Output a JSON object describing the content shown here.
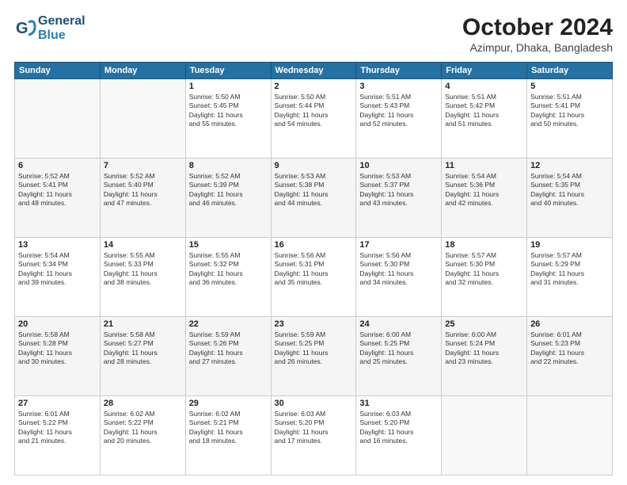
{
  "header": {
    "logo_line1": "General",
    "logo_line2": "Blue",
    "month": "October 2024",
    "location": "Azimpur, Dhaka, Bangladesh"
  },
  "weekdays": [
    "Sunday",
    "Monday",
    "Tuesday",
    "Wednesday",
    "Thursday",
    "Friday",
    "Saturday"
  ],
  "weeks": [
    [
      {
        "day": "",
        "info": ""
      },
      {
        "day": "",
        "info": ""
      },
      {
        "day": "1",
        "info": "Sunrise: 5:50 AM\nSunset: 5:45 PM\nDaylight: 11 hours\nand 55 minutes."
      },
      {
        "day": "2",
        "info": "Sunrise: 5:50 AM\nSunset: 5:44 PM\nDaylight: 11 hours\nand 54 minutes."
      },
      {
        "day": "3",
        "info": "Sunrise: 5:51 AM\nSunset: 5:43 PM\nDaylight: 11 hours\nand 52 minutes."
      },
      {
        "day": "4",
        "info": "Sunrise: 5:51 AM\nSunset: 5:42 PM\nDaylight: 11 hours\nand 51 minutes."
      },
      {
        "day": "5",
        "info": "Sunrise: 5:51 AM\nSunset: 5:41 PM\nDaylight: 11 hours\nand 50 minutes."
      }
    ],
    [
      {
        "day": "6",
        "info": "Sunrise: 5:52 AM\nSunset: 5:41 PM\nDaylight: 11 hours\nand 48 minutes."
      },
      {
        "day": "7",
        "info": "Sunrise: 5:52 AM\nSunset: 5:40 PM\nDaylight: 11 hours\nand 47 minutes."
      },
      {
        "day": "8",
        "info": "Sunrise: 5:52 AM\nSunset: 5:39 PM\nDaylight: 11 hours\nand 46 minutes."
      },
      {
        "day": "9",
        "info": "Sunrise: 5:53 AM\nSunset: 5:38 PM\nDaylight: 11 hours\nand 44 minutes."
      },
      {
        "day": "10",
        "info": "Sunrise: 5:53 AM\nSunset: 5:37 PM\nDaylight: 11 hours\nand 43 minutes."
      },
      {
        "day": "11",
        "info": "Sunrise: 5:54 AM\nSunset: 5:36 PM\nDaylight: 11 hours\nand 42 minutes."
      },
      {
        "day": "12",
        "info": "Sunrise: 5:54 AM\nSunset: 5:35 PM\nDaylight: 11 hours\nand 40 minutes."
      }
    ],
    [
      {
        "day": "13",
        "info": "Sunrise: 5:54 AM\nSunset: 5:34 PM\nDaylight: 11 hours\nand 39 minutes."
      },
      {
        "day": "14",
        "info": "Sunrise: 5:55 AM\nSunset: 5:33 PM\nDaylight: 11 hours\nand 38 minutes."
      },
      {
        "day": "15",
        "info": "Sunrise: 5:55 AM\nSunset: 5:32 PM\nDaylight: 11 hours\nand 36 minutes."
      },
      {
        "day": "16",
        "info": "Sunrise: 5:56 AM\nSunset: 5:31 PM\nDaylight: 11 hours\nand 35 minutes."
      },
      {
        "day": "17",
        "info": "Sunrise: 5:56 AM\nSunset: 5:30 PM\nDaylight: 11 hours\nand 34 minutes."
      },
      {
        "day": "18",
        "info": "Sunrise: 5:57 AM\nSunset: 5:30 PM\nDaylight: 11 hours\nand 32 minutes."
      },
      {
        "day": "19",
        "info": "Sunrise: 5:57 AM\nSunset: 5:29 PM\nDaylight: 11 hours\nand 31 minutes."
      }
    ],
    [
      {
        "day": "20",
        "info": "Sunrise: 5:58 AM\nSunset: 5:28 PM\nDaylight: 11 hours\nand 30 minutes."
      },
      {
        "day": "21",
        "info": "Sunrise: 5:58 AM\nSunset: 5:27 PM\nDaylight: 11 hours\nand 28 minutes."
      },
      {
        "day": "22",
        "info": "Sunrise: 5:59 AM\nSunset: 5:26 PM\nDaylight: 11 hours\nand 27 minutes."
      },
      {
        "day": "23",
        "info": "Sunrise: 5:59 AM\nSunset: 5:25 PM\nDaylight: 11 hours\nand 26 minutes."
      },
      {
        "day": "24",
        "info": "Sunrise: 6:00 AM\nSunset: 5:25 PM\nDaylight: 11 hours\nand 25 minutes."
      },
      {
        "day": "25",
        "info": "Sunrise: 6:00 AM\nSunset: 5:24 PM\nDaylight: 11 hours\nand 23 minutes."
      },
      {
        "day": "26",
        "info": "Sunrise: 6:01 AM\nSunset: 5:23 PM\nDaylight: 11 hours\nand 22 minutes."
      }
    ],
    [
      {
        "day": "27",
        "info": "Sunrise: 6:01 AM\nSunset: 5:22 PM\nDaylight: 11 hours\nand 21 minutes."
      },
      {
        "day": "28",
        "info": "Sunrise: 6:02 AM\nSunset: 5:22 PM\nDaylight: 11 hours\nand 20 minutes."
      },
      {
        "day": "29",
        "info": "Sunrise: 6:02 AM\nSunset: 5:21 PM\nDaylight: 11 hours\nand 18 minutes."
      },
      {
        "day": "30",
        "info": "Sunrise: 6:03 AM\nSunset: 5:20 PM\nDaylight: 11 hours\nand 17 minutes."
      },
      {
        "day": "31",
        "info": "Sunrise: 6:03 AM\nSunset: 5:20 PM\nDaylight: 11 hours\nand 16 minutes."
      },
      {
        "day": "",
        "info": ""
      },
      {
        "day": "",
        "info": ""
      }
    ]
  ]
}
